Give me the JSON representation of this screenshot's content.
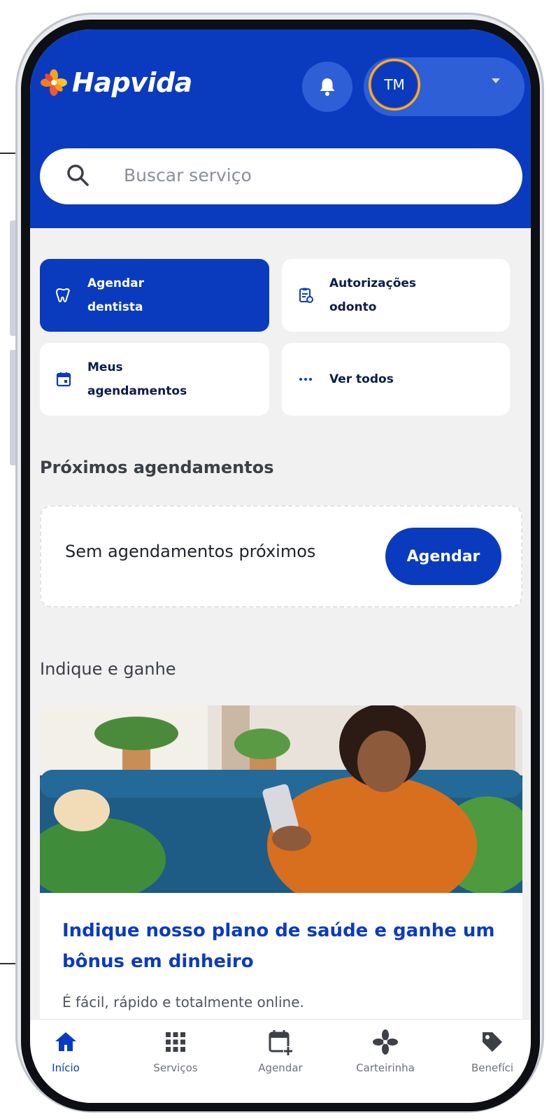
{
  "header": {
    "brand": "Hapvida",
    "avatar_initials": "TM"
  },
  "search": {
    "placeholder": "Buscar serviço"
  },
  "quick_actions": [
    {
      "line1": "Agendar",
      "line2": "dentista",
      "icon": "tooth-icon"
    },
    {
      "line1": "Autorizações",
      "line2": "odonto",
      "icon": "clipboard-icon"
    },
    {
      "line1": "Meus",
      "line2": "agendamentos",
      "icon": "calendar-icon"
    },
    {
      "line1": "Ver todos",
      "line2": "",
      "icon": "more-dots-icon"
    }
  ],
  "upcoming": {
    "title": "Próximos agendamentos",
    "empty_text": "Sem agendamentos próximos",
    "button": "Agendar"
  },
  "referral": {
    "title": "Indique e ganhe",
    "card_title": "Indique nosso plano de saúde e ganhe um bônus em dinheiro",
    "card_subtitle": "É fácil, rápido e totalmente online."
  },
  "bottom_nav": [
    {
      "label": "Início",
      "icon": "home-icon",
      "active": true
    },
    {
      "label": "Serviços",
      "icon": "grid-icon",
      "active": false
    },
    {
      "label": "Agendar",
      "icon": "calendar-add-icon",
      "active": false
    },
    {
      "label": "Carteirinha",
      "icon": "card-icon",
      "active": false
    },
    {
      "label": "Benefíci",
      "icon": "tag-icon",
      "active": false
    }
  ],
  "colors": {
    "primary": "#0a3bbf",
    "background": "#f1f1f2"
  }
}
